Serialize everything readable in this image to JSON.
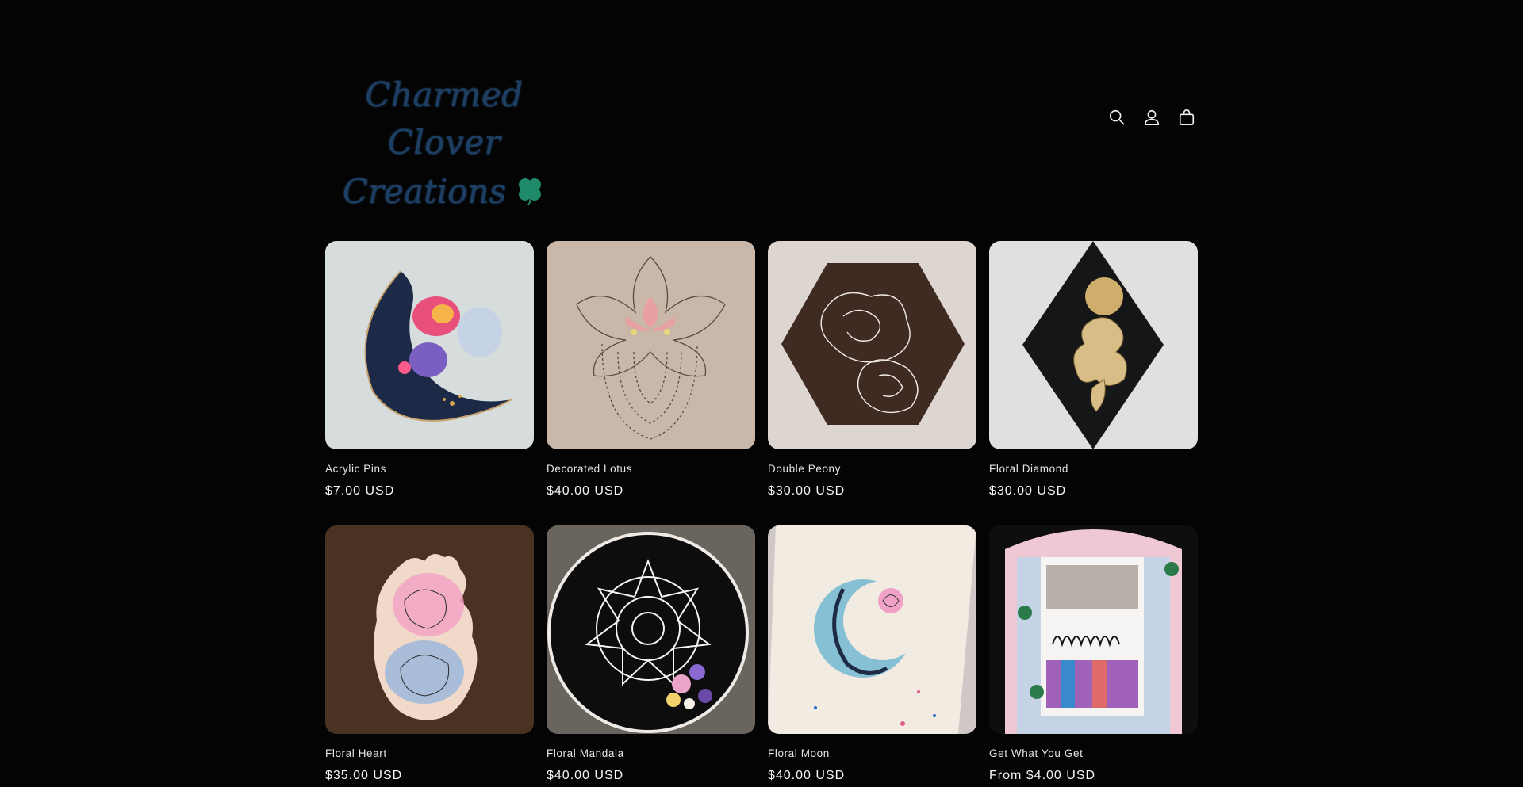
{
  "store": {
    "logo_line1": "Charmed Clover",
    "logo_line2": "Creations"
  },
  "header": {
    "icons": [
      "search-icon",
      "account-icon",
      "cart-icon"
    ]
  },
  "products": [
    {
      "title": "Acrylic Pins",
      "price": "$7.00 USD"
    },
    {
      "title": "Decorated Lotus",
      "price": "$40.00 USD"
    },
    {
      "title": "Double Peony",
      "price": "$30.00 USD"
    },
    {
      "title": "Floral Diamond",
      "price": "$30.00 USD"
    },
    {
      "title": "Floral Heart",
      "price": "$35.00 USD"
    },
    {
      "title": "Floral Mandala",
      "price": "$40.00 USD"
    },
    {
      "title": "Floral Moon",
      "price": "$40.00 USD"
    },
    {
      "title": "Get What You Get",
      "price": "From $4.00 USD"
    }
  ],
  "colors": {
    "background": "#040404",
    "logo_text": "#1c3f63",
    "clover": "#1f8a6a",
    "text": "#f2f2f2"
  }
}
